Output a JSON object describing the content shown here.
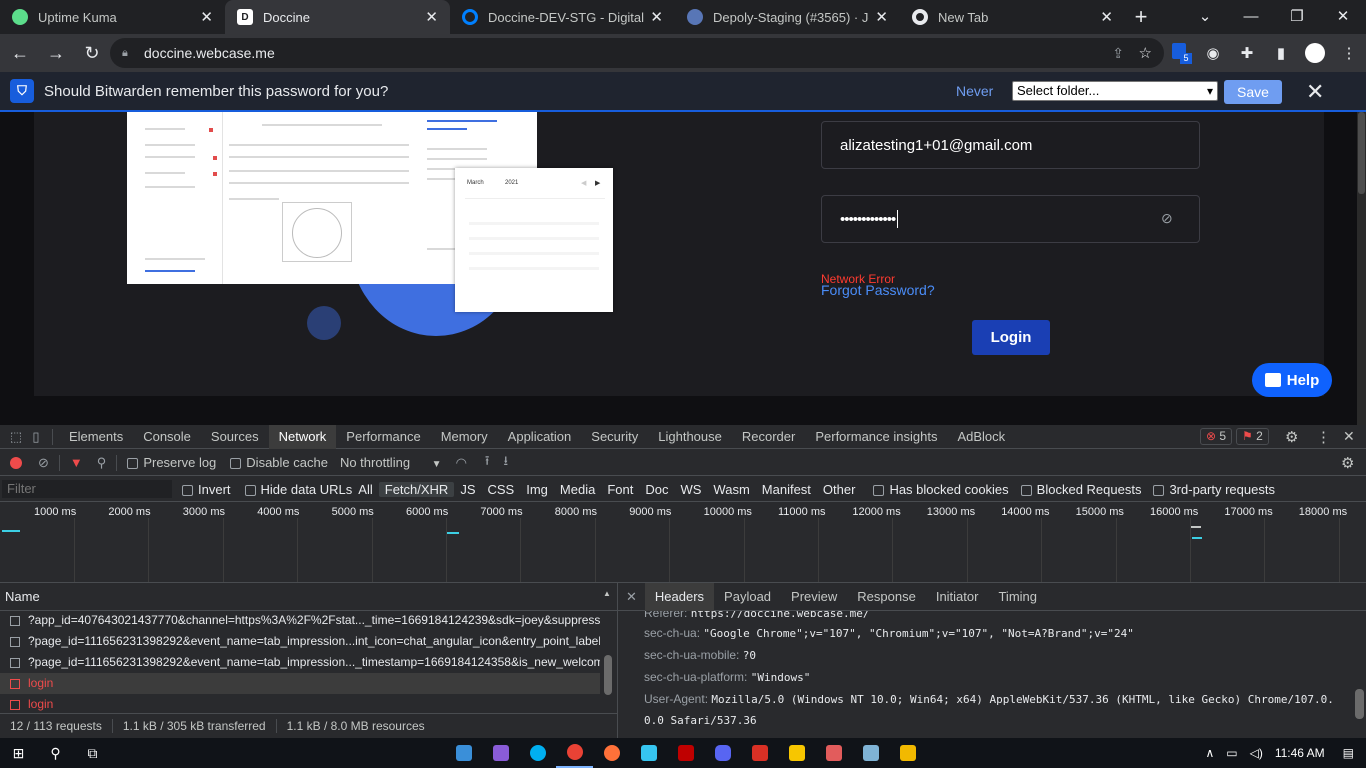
{
  "browser": {
    "tabs": [
      {
        "title": "Uptime Kuma",
        "icon": "uptime-kuma-icon",
        "color": "#5cdd8b"
      },
      {
        "title": "Doccine",
        "icon": "doccine-icon",
        "color": "#ffffff"
      },
      {
        "title": "Doccine-DEV-STG - DigitalOc",
        "icon": "digitalocean-icon",
        "color": "#0080ff"
      },
      {
        "title": "Depoly-Staging (#3565) · Job",
        "icon": "jenkins-icon",
        "color": "#5876b6"
      },
      {
        "title": "New Tab",
        "icon": "chrome-icon",
        "color": "#e8eaed"
      }
    ],
    "new_tab": "+",
    "url": "doccine.webcase.me",
    "extension_badge": "5"
  },
  "bitwarden": {
    "question": "Should Bitwarden remember this password for you?",
    "never": "Never",
    "folder_select": "Select folder...",
    "save": "Save"
  },
  "login": {
    "email": "alizatesting1+01@gmail.com",
    "password_mask": "•••••••••••••",
    "error": "Network Error",
    "forgot": "Forgot Password?",
    "button": "Login",
    "help": "Help"
  },
  "illustration": {
    "month": "March",
    "year": "2021",
    "selected_day": "18"
  },
  "devtools": {
    "tabs": [
      "Elements",
      "Console",
      "Sources",
      "Network",
      "Performance",
      "Memory",
      "Application",
      "Security",
      "Lighthouse",
      "Recorder",
      "Performance insights",
      "AdBlock"
    ],
    "active_tab": "Network",
    "error_count": "5",
    "warning_count": "2",
    "network_toolbar": {
      "preserve_log": "Preserve log",
      "disable_cache": "Disable cache",
      "throttling": "No throttling"
    },
    "filter": {
      "placeholder": "Filter",
      "invert": "Invert",
      "hide_data_urls": "Hide data URLs",
      "types": [
        "All",
        "Fetch/XHR",
        "JS",
        "CSS",
        "Img",
        "Media",
        "Font",
        "Doc",
        "WS",
        "Wasm",
        "Manifest",
        "Other"
      ],
      "active_type": "Fetch/XHR",
      "has_blocked_cookies": "Has blocked cookies",
      "blocked_requests": "Blocked Requests",
      "third_party": "3rd-party requests"
    },
    "timeline_ticks": [
      "1000 ms",
      "2000 ms",
      "3000 ms",
      "4000 ms",
      "5000 ms",
      "6000 ms",
      "7000 ms",
      "8000 ms",
      "9000 ms",
      "10000 ms",
      "11000 ms",
      "12000 ms",
      "13000 ms",
      "14000 ms",
      "15000 ms",
      "16000 ms",
      "17000 ms",
      "18000 ms"
    ],
    "name_header": "Name",
    "requests": [
      {
        "name": "?app_id=407643021437770&channel=https%3A%2F%2Fstat..._time=1669184124239&sdk=joey&suppress_h",
        "error": false
      },
      {
        "name": "?page_id=111656231398292&event_name=tab_impression...int_icon=chat_angular_icon&entry_point_label=",
        "error": false
      },
      {
        "name": "?page_id=111656231398292&event_name=tab_impression..._timestamp=1669184124358&is_new_welcome_",
        "error": false
      },
      {
        "name": "login",
        "error": true
      },
      {
        "name": "login",
        "error": true
      }
    ],
    "detail_tabs": [
      "Headers",
      "Payload",
      "Preview",
      "Response",
      "Initiator",
      "Timing"
    ],
    "active_detail_tab": "Headers",
    "headers": [
      {
        "key": "Referer:",
        "value": "https://doccine.webcase.me/"
      },
      {
        "key": "sec-ch-ua:",
        "value": "\"Google Chrome\";v=\"107\", \"Chromium\";v=\"107\", \"Not=A?Brand\";v=\"24\""
      },
      {
        "key": "sec-ch-ua-mobile:",
        "value": "?0"
      },
      {
        "key": "sec-ch-ua-platform:",
        "value": "\"Windows\""
      },
      {
        "key": "User-Agent:",
        "value": "Mozilla/5.0 (Windows NT 10.0; Win64; x64) AppleWebKit/537.36 (KHTML, like Gecko) Chrome/107.0."
      },
      {
        "key": "",
        "value": "0.0 Safari/537.36"
      }
    ],
    "status": {
      "requests": "12 / 113 requests",
      "transferred": "1.1 kB / 305 kB transferred",
      "resources": "1.1 kB / 8.0 MB resources"
    }
  },
  "taskbar": {
    "time": "11:46 AM"
  }
}
